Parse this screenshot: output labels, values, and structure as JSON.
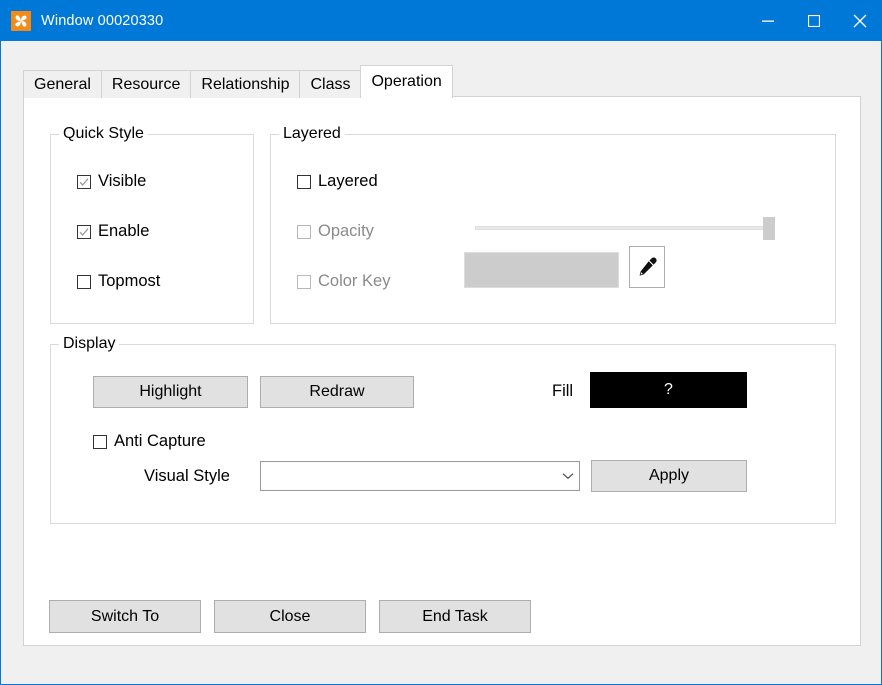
{
  "window": {
    "title": "Window 00020330",
    "icon": "pinwheel-icon",
    "accent_color": "#0078d7",
    "background_color": "#f0f0f0",
    "controls": {
      "minimize": "minimize-icon",
      "maximize": "maximize-icon",
      "close": "close-icon"
    }
  },
  "tabs": [
    {
      "label": "General",
      "active": false
    },
    {
      "label": "Resource",
      "active": false
    },
    {
      "label": "Relationship",
      "active": false
    },
    {
      "label": "Class",
      "active": false
    },
    {
      "label": "Operation",
      "active": true
    }
  ],
  "quick_style": {
    "title": "Quick Style",
    "checkboxes": [
      {
        "label": "Visible",
        "checked": true,
        "enabled": true
      },
      {
        "label": "Enable",
        "checked": true,
        "enabled": true
      },
      {
        "label": "Topmost",
        "checked": false,
        "enabled": true
      }
    ]
  },
  "layered": {
    "title": "Layered",
    "layered_checkbox": {
      "label": "Layered",
      "checked": false,
      "enabled": true
    },
    "opacity": {
      "label": "Opacity",
      "checked": false,
      "enabled": false,
      "slider_value": 100,
      "slider_min": 0,
      "slider_max": 100
    },
    "color_key": {
      "label": "Color Key",
      "checked": false,
      "enabled": false,
      "swatch_color": "#cccccc",
      "picker_button": "eyedropper-icon"
    }
  },
  "display": {
    "title": "Display",
    "highlight_label": "Highlight",
    "redraw_label": "Redraw",
    "anti_capture": {
      "label": "Anti Capture",
      "checked": false
    },
    "fill_label": "Fill",
    "fill_value": "?",
    "fill_color": "#000000",
    "visual_style_label": "Visual Style",
    "visual_style_value": "",
    "apply_label": "Apply"
  },
  "footer": {
    "switch_to_label": "Switch To",
    "close_label": "Close",
    "end_task_label": "End Task"
  }
}
